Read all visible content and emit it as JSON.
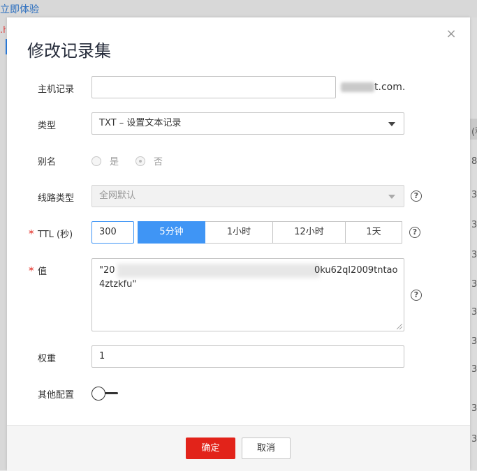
{
  "background": {
    "link_text": "立即体验",
    "row_numbers": [
      "8",
      "3",
      "3",
      "3",
      "3",
      "3",
      "3",
      "3",
      "3",
      "3"
    ],
    "header_fragment": "(积"
  },
  "dialog": {
    "title": "修改记录集",
    "close_icon": "×",
    "fields": {
      "host": {
        "label": "主机记录",
        "value": "",
        "suffix": "t.com."
      },
      "type": {
        "label": "类型",
        "value": "TXT – 设置文本记录"
      },
      "alias": {
        "label": "别名",
        "options": [
          "是",
          "否"
        ],
        "selected": "否"
      },
      "line": {
        "label": "线路类型",
        "value": "全网默认"
      },
      "ttl": {
        "label": "TTL (秒)",
        "value": "300",
        "presets": [
          "5分钟",
          "1小时",
          "12小时",
          "1天"
        ],
        "active": "5分钟"
      },
      "value": {
        "label": "值",
        "line1_start": "\"20",
        "line1_end": "0ku62ql2009tntao",
        "line2": "4ztzkfu\""
      },
      "weight": {
        "label": "权重",
        "value": "1"
      },
      "other": {
        "label": "其他配置"
      }
    },
    "help_glyph": "?",
    "required_mark": "*",
    "footer": {
      "confirm": "确定",
      "cancel": "取消"
    }
  },
  "colors": {
    "primary": "#e2231a",
    "accent": "#3f95f5"
  }
}
